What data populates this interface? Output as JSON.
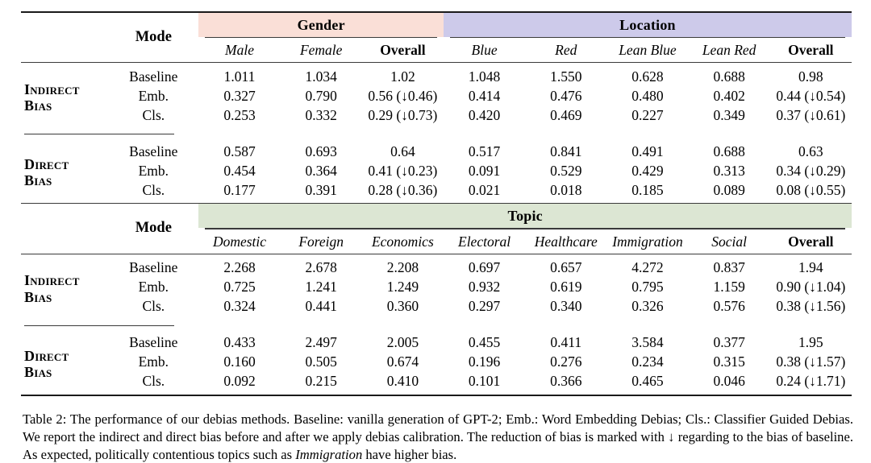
{
  "table": {
    "mode_header": "Mode",
    "groups": {
      "gender": {
        "label": "Gender",
        "color": "#fadfd7"
      },
      "location": {
        "label": "Location",
        "color": "#cdcaea"
      },
      "topic": {
        "label": "Topic",
        "color": "#dce6d3"
      }
    },
    "block1": {
      "gender_columns": [
        "Male",
        "Female",
        "Overall"
      ],
      "location_columns": [
        "Blue",
        "Red",
        "Lean Blue",
        "Lean Red",
        "Overall"
      ],
      "sections": [
        {
          "label_line1": "Indirect",
          "label_line2": "Bias",
          "rows": [
            {
              "mode": "Baseline",
              "values": [
                "1.011",
                "1.034",
                "1.02",
                "1.048",
                "1.550",
                "0.628",
                "0.688",
                "0.98"
              ]
            },
            {
              "mode": "Emb.",
              "values": [
                "0.327",
                "0.790",
                "0.56 (↓0.46)",
                "0.414",
                "0.476",
                "0.480",
                "0.402",
                "0.44 (↓0.54)"
              ]
            },
            {
              "mode": "Cls.",
              "values": [
                "0.253",
                "0.332",
                "0.29 (↓0.73)",
                "0.420",
                "0.469",
                "0.227",
                "0.349",
                "0.37 (↓0.61)"
              ]
            }
          ]
        },
        {
          "label_line1": "Direct",
          "label_line2": "Bias",
          "rows": [
            {
              "mode": "Baseline",
              "values": [
                "0.587",
                "0.693",
                "0.64",
                "0.517",
                "0.841",
                "0.491",
                "0.688",
                "0.63"
              ]
            },
            {
              "mode": "Emb.",
              "values": [
                "0.454",
                "0.364",
                "0.41 (↓0.23)",
                "0.091",
                "0.529",
                "0.429",
                "0.313",
                "0.34 (↓0.29)"
              ]
            },
            {
              "mode": "Cls.",
              "values": [
                "0.177",
                "0.391",
                "0.28 (↓0.36)",
                "0.021",
                "0.018",
                "0.185",
                "0.089",
                "0.08 (↓0.55)"
              ]
            }
          ]
        }
      ]
    },
    "block2": {
      "topic_columns": [
        "Domestic",
        "Foreign",
        "Economics",
        "Electoral",
        "Healthcare",
        "Immigration",
        "Social",
        "Overall"
      ],
      "sections": [
        {
          "label_line1": "Indirect",
          "label_line2": "Bias",
          "rows": [
            {
              "mode": "Baseline",
              "values": [
                "2.268",
                "2.678",
                "2.208",
                "0.697",
                "0.657",
                "4.272",
                "0.837",
                "1.94"
              ]
            },
            {
              "mode": "Emb.",
              "values": [
                "0.725",
                "1.241",
                "1.249",
                "0.932",
                "0.619",
                "0.795",
                "1.159",
                "0.90 (↓1.04)"
              ]
            },
            {
              "mode": "Cls.",
              "values": [
                "0.324",
                "0.441",
                "0.360",
                "0.297",
                "0.340",
                "0.326",
                "0.576",
                "0.38 (↓1.56)"
              ]
            }
          ]
        },
        {
          "label_line1": "Direct",
          "label_line2": "Bias",
          "rows": [
            {
              "mode": "Baseline",
              "values": [
                "0.433",
                "2.497",
                "2.005",
                "0.455",
                "0.411",
                "3.584",
                "0.377",
                "1.95"
              ]
            },
            {
              "mode": "Emb.",
              "values": [
                "0.160",
                "0.505",
                "0.674",
                "0.196",
                "0.276",
                "0.234",
                "0.315",
                "0.38 (↓1.57)"
              ]
            },
            {
              "mode": "Cls.",
              "values": [
                "0.092",
                "0.215",
                "0.410",
                "0.101",
                "0.366",
                "0.465",
                "0.046",
                "0.24 (↓1.71)"
              ]
            }
          ]
        }
      ]
    }
  },
  "caption": {
    "part1": "Table 2: The performance of our debias methods. Baseline: vanilla generation of GPT-2; Emb.: Word Embedding Debias; Cls.: Classifier Guided Debias. We report the indirect and direct bias before and after we apply debias calibration. The reduction of bias is marked with ↓ regarding to the bias of baseline. As expected, politically contentious topics such as ",
    "emphasis": "Immigration",
    "part2": " have higher bias."
  }
}
